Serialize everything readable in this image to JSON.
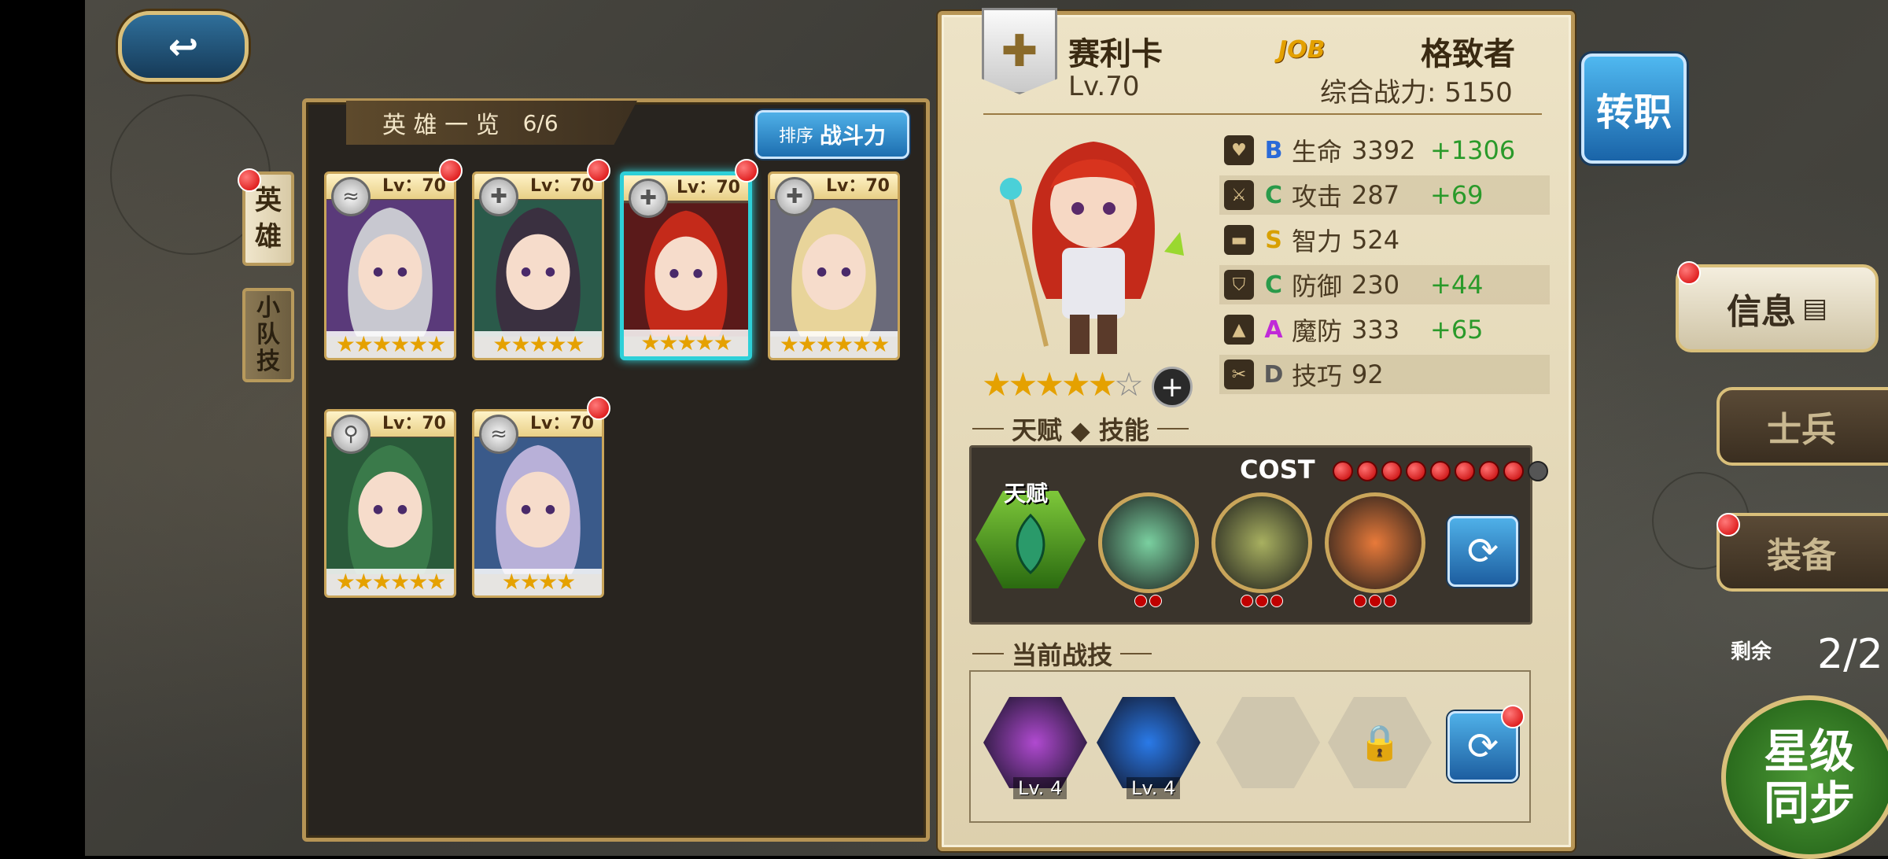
{
  "top": {
    "back_icon": "back-arrow-icon"
  },
  "hero_list": {
    "title": "英 雄 一 览",
    "count": "6/6",
    "sort_prefix": "排序",
    "sort_value": "战斗力",
    "tabs": [
      {
        "label": "英\n雄"
      },
      {
        "label": "小\n队\n技"
      }
    ],
    "heroes": [
      {
        "level": "Lv：70",
        "class_icon": "wave",
        "stars": 6,
        "has_alert": true,
        "selected": false,
        "hair": "#c8c8d0",
        "bg": "#5a3a7a"
      },
      {
        "level": "Lv：70",
        "class_icon": "cross",
        "stars": 5,
        "has_alert": true,
        "selected": false,
        "hair": "#3a3040",
        "bg": "#2a5a4a"
      },
      {
        "level": "Lv：70",
        "class_icon": "cross",
        "stars": 5,
        "has_alert": true,
        "selected": true,
        "hair": "#c42a1a",
        "bg": "#5a1a1a"
      },
      {
        "level": "Lv：70",
        "class_icon": "cross",
        "stars": 6,
        "has_alert": false,
        "selected": false,
        "hair": "#e8d49a",
        "bg": "#6a6a7a"
      },
      {
        "level": "Lv：70",
        "class_icon": "magnify",
        "stars": 6,
        "has_alert": false,
        "selected": false,
        "hair": "#3a7a4a",
        "bg": "#2a5a3a"
      },
      {
        "level": "Lv：70",
        "class_icon": "wave",
        "stars": 4,
        "has_alert": true,
        "selected": false,
        "hair": "#b8b0d8",
        "bg": "#3a5a8a"
      }
    ]
  },
  "detail": {
    "name": "赛利卡",
    "level": "Lv.70",
    "job_label": "JOB",
    "job_name": "格致者",
    "power": "综合战力: 5150",
    "stars_filled": "★★★★★",
    "stars_empty": "☆",
    "stats": [
      {
        "icon": "heart-icon",
        "grade": "B",
        "grade_color": "#2a6ad8",
        "label": "生命",
        "value": "3392",
        "bonus": "+1306"
      },
      {
        "icon": "sword-icon",
        "grade": "C",
        "grade_color": "#2a9a4a",
        "label": "攻击",
        "value": "287",
        "bonus": "+69"
      },
      {
        "icon": "book-icon",
        "grade": "S",
        "grade_color": "#d8a000",
        "label": "智力",
        "value": "524",
        "bonus": ""
      },
      {
        "icon": "shield-icon",
        "grade": "C",
        "grade_color": "#2a9a4a",
        "label": "防御",
        "value": "230",
        "bonus": "+44"
      },
      {
        "icon": "hat-icon",
        "grade": "A",
        "grade_color": "#c02ad8",
        "label": "魔防",
        "value": "333",
        "bonus": "+65"
      },
      {
        "icon": "scissors-icon",
        "grade": "D",
        "grade_color": "#5a5a5a",
        "label": "技巧",
        "value": "92",
        "bonus": ""
      }
    ],
    "talent_title": "天赋 ◆ 技能",
    "cost_label": "COST",
    "cost_pips_active": 8,
    "cost_pips_total": 9,
    "talent_label": "天赋",
    "skills": [
      {
        "color": "#7ad0a0",
        "pips": 2
      },
      {
        "color": "#a8b060",
        "pips": 3
      },
      {
        "color": "#e87a3a",
        "pips": 3
      }
    ],
    "battle_title": "当前战技",
    "battle_skills": [
      {
        "level": "Lv. 4",
        "color": "#b04ad0"
      },
      {
        "level": "Lv. 4",
        "color": "#2a7ae8"
      }
    ]
  },
  "right": {
    "job_change": "转职",
    "info": "信息",
    "soldier": "士兵",
    "equip": "装备",
    "remain_label": "剩余",
    "remain_value": "2/2",
    "sync": "星级\n同步"
  }
}
